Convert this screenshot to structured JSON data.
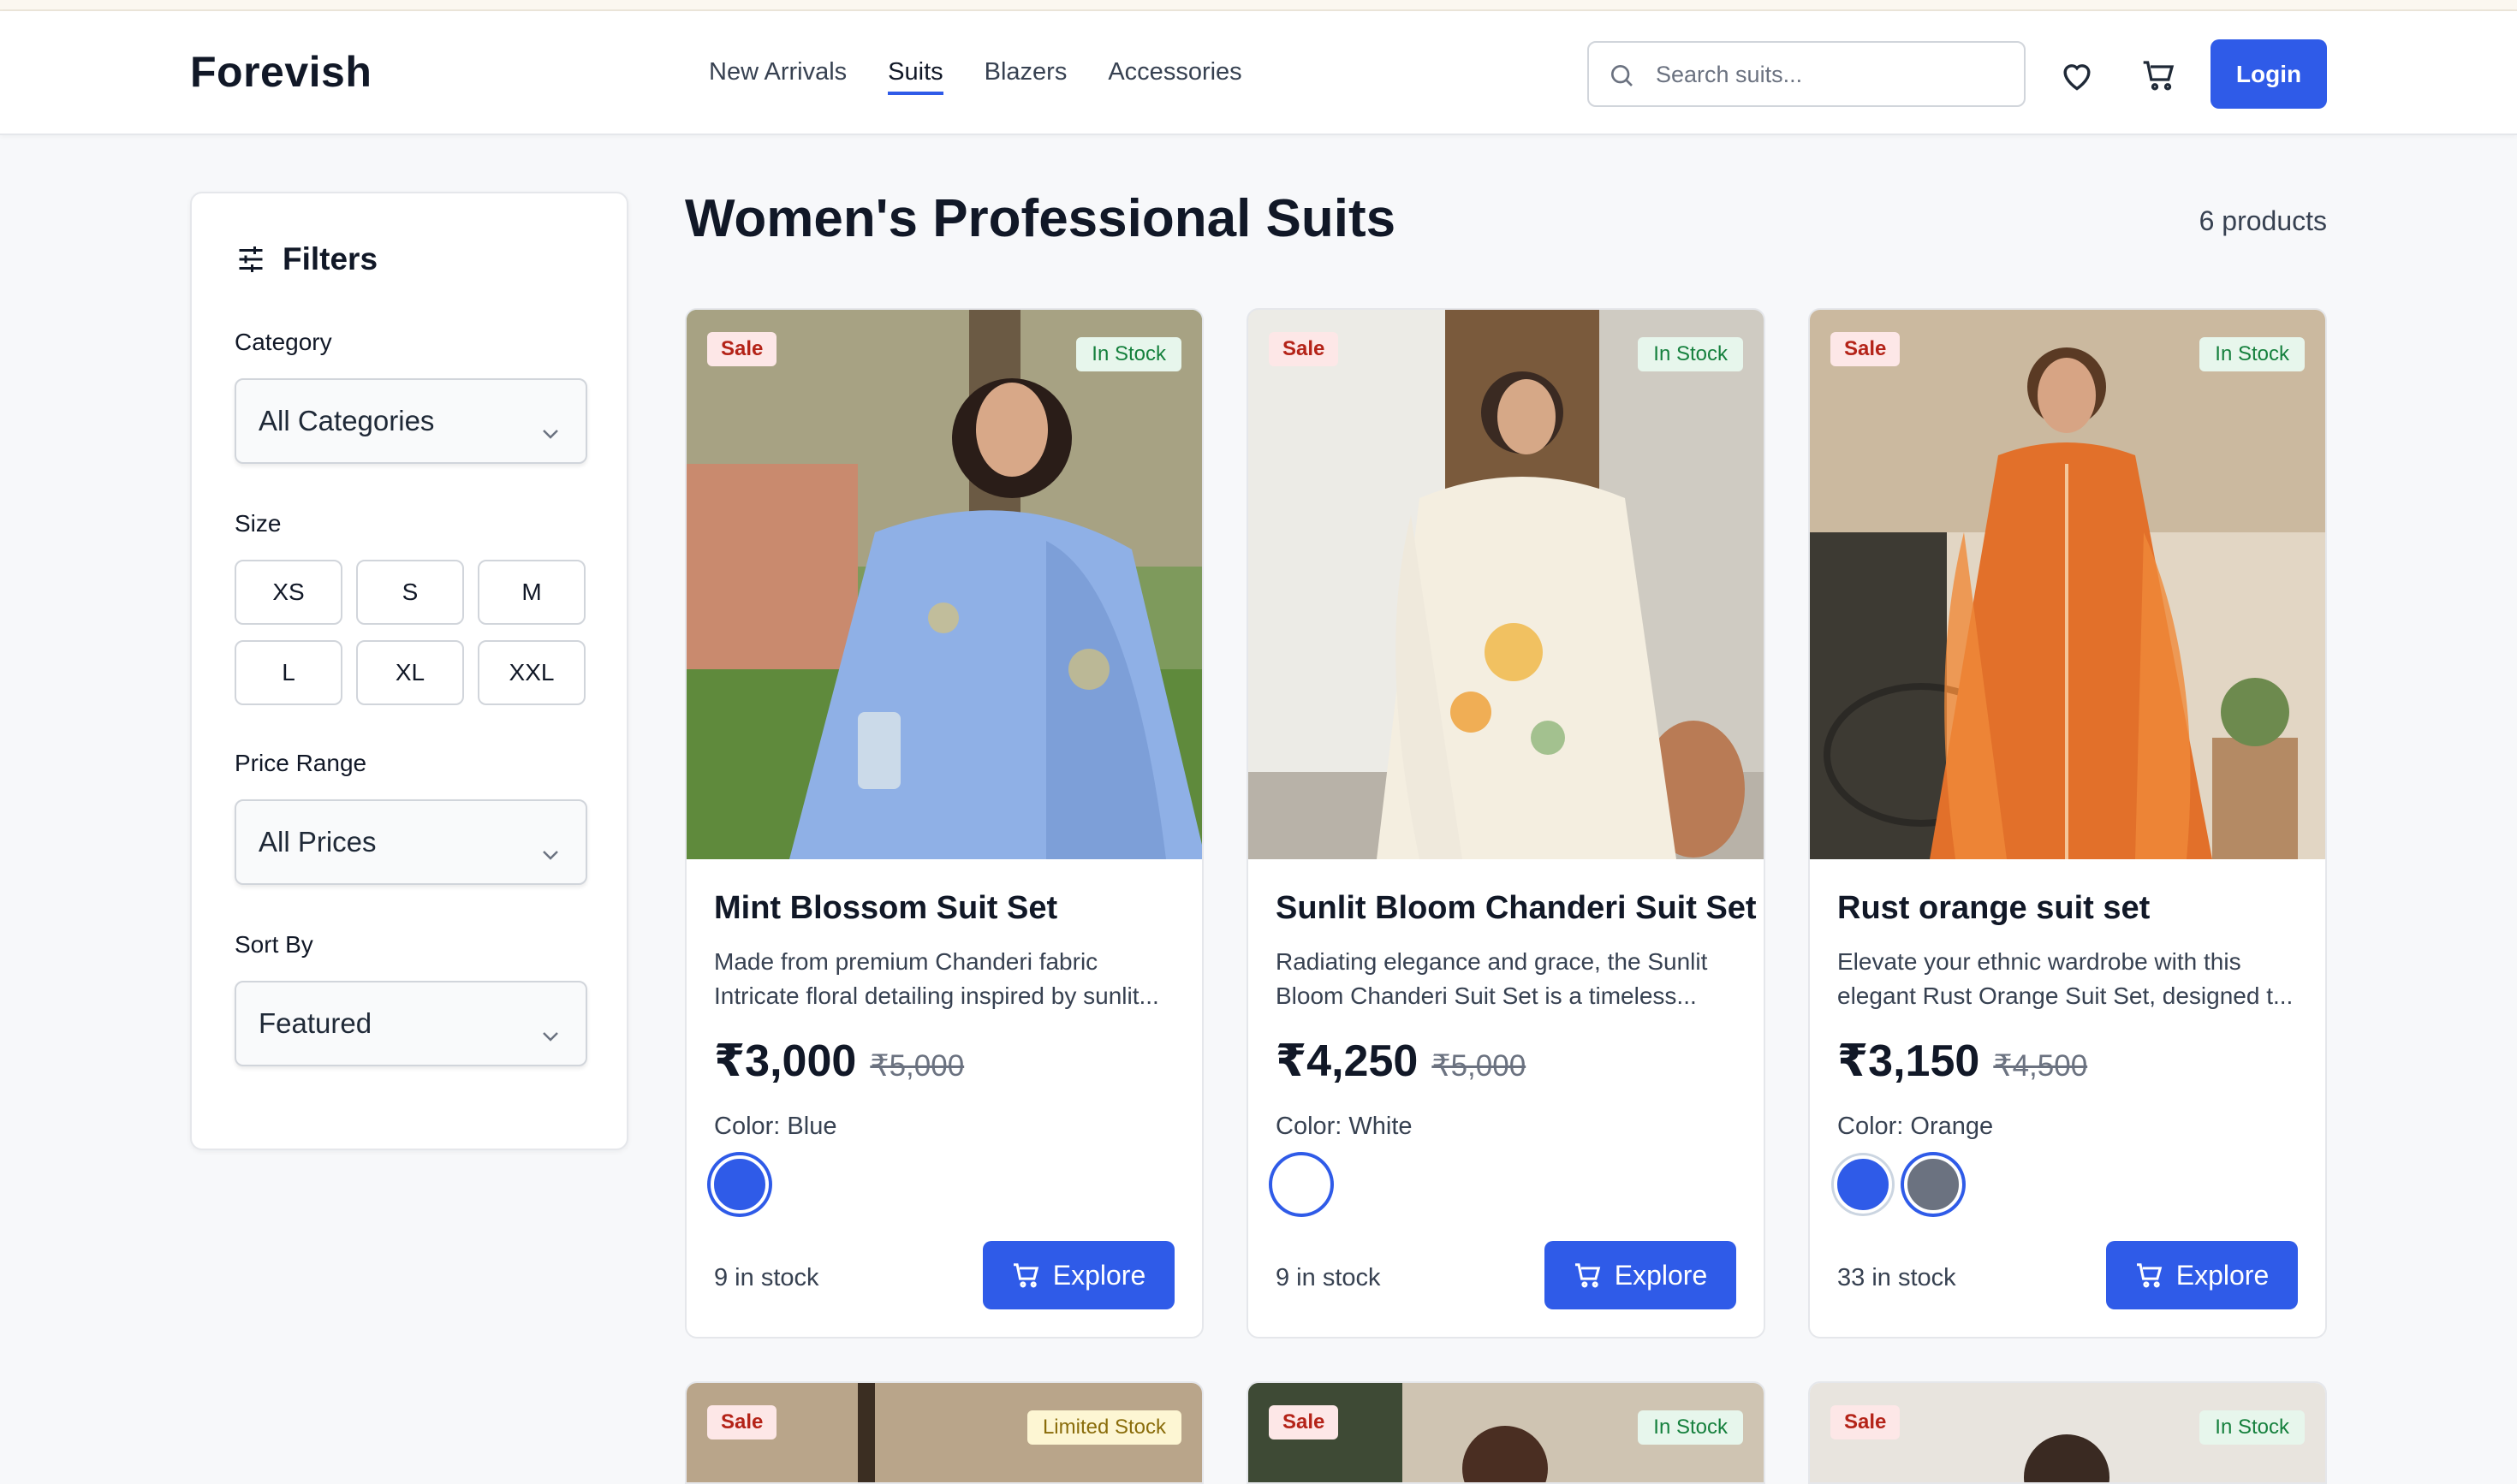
{
  "header": {
    "brand": "Forevish",
    "nav": [
      "New Arrivals",
      "Suits",
      "Blazers",
      "Accessories"
    ],
    "active_nav": "Suits",
    "search_placeholder": "Search suits...",
    "login_label": "Login"
  },
  "filters": {
    "title": "Filters",
    "category_label": "Category",
    "category_value": "All Categories",
    "size_label": "Size",
    "sizes": [
      "XS",
      "S",
      "M",
      "L",
      "XL",
      "XXL"
    ],
    "price_label": "Price Range",
    "price_value": "All Prices",
    "sort_label": "Sort By",
    "sort_value": "Featured"
  },
  "main": {
    "title": "Women's Professional Suits",
    "count": "6 products"
  },
  "products": [
    {
      "name": "Mint Blossom Suit Set",
      "desc": "Made from premium Chanderi fabric Intricate floral detailing inspired by sunlit...",
      "price": "₹3,000",
      "was": "₹5,000",
      "color": "Color: Blue",
      "stock": "9 in stock",
      "sale": "Sale",
      "badge": "In Stock",
      "explore": "Explore"
    },
    {
      "name": "Sunlit Bloom Chanderi Suit Set",
      "desc": "Radiating elegance and grace, the Sunlit Bloom Chanderi Suit Set is a timeless...",
      "price": "₹4,250",
      "was": "₹5,000",
      "color": "Color: White",
      "stock": "9 in stock",
      "sale": "Sale",
      "badge": "In Stock",
      "explore": "Explore"
    },
    {
      "name": "Rust orange suit set",
      "desc": "Elevate your ethnic wardrobe with this elegant Rust Orange Suit Set, designed t...",
      "price": "₹3,150",
      "was": "₹4,500",
      "color": "Color: Orange",
      "stock": "33 in stock",
      "sale": "Sale",
      "badge": "In Stock",
      "explore": "Explore"
    }
  ],
  "next_row": [
    {
      "sale": "Sale",
      "badge": "Limited Stock"
    },
    {
      "sale": "Sale",
      "badge": "In Stock"
    },
    {
      "sale": "Sale",
      "badge": "In Stock"
    }
  ],
  "colors": {
    "accent": "#2f5be8",
    "swatch_blue": "#2f5be8",
    "swatch_white": "#ffffff",
    "swatch_gray": "#6b7280"
  }
}
